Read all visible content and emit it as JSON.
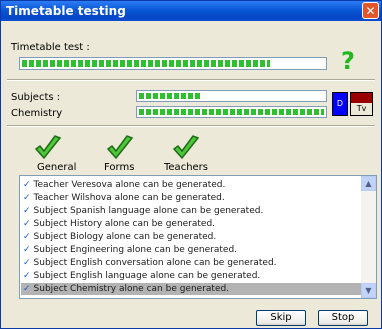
{
  "window": {
    "title": "Timetable testing",
    "close_label": "✕"
  },
  "overall": {
    "label": "Timetable test :",
    "progress": 0.82,
    "status_icon": "question-mark",
    "status_glyph": "?",
    "status_color": "#1fb81f"
  },
  "subjects": {
    "label": "Subjects :",
    "progress": 1.0
  },
  "current": {
    "label": "Chemistry",
    "progress": 1.0
  },
  "indicators": {
    "blue_text": "D",
    "tv_label": "Tv"
  },
  "checks": [
    {
      "label": "General"
    },
    {
      "label": "Forms"
    },
    {
      "label": "Teachers"
    }
  ],
  "log": [
    "Teacher Veresova alone can be generated.",
    "Teacher Wilshova alone can be generated.",
    "Subject Spanish language alone can be generated.",
    "Subject History alone can be generated.",
    "Subject Biology alone can be generated.",
    "Subject Engineering alone can be generated.",
    "Subject English conversation alone can be generated.",
    "Subject English language alone can be generated.",
    "Subject Chemistry alone can be generated."
  ],
  "log_selected": 8,
  "buttons": {
    "skip": "Skip",
    "stop": "Stop"
  }
}
